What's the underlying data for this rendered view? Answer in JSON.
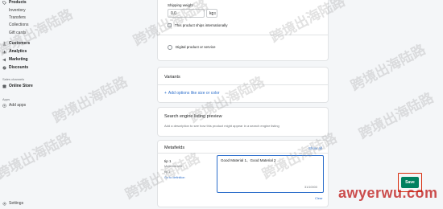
{
  "sidebar": {
    "items": [
      {
        "label": "Products",
        "icon": "tag-icon"
      },
      {
        "label": "Inventory"
      },
      {
        "label": "Transfers"
      },
      {
        "label": "Collections"
      },
      {
        "label": "Gift cards"
      },
      {
        "label": "Customers",
        "icon": "person-icon"
      },
      {
        "label": "Analytics",
        "icon": "chart-icon"
      },
      {
        "label": "Marketing",
        "icon": "megaphone-icon"
      },
      {
        "label": "Discounts",
        "icon": "discount-icon"
      }
    ],
    "sales_channels_label": "Sales channels",
    "online_store_label": "Online Store",
    "apps_label": "Apps",
    "add_apps_label": "Add apps",
    "settings_label": "Settings"
  },
  "shipping": {
    "weight_label": "Shipping weight",
    "weight_value": "0.0",
    "weight_unit": "kg",
    "ships_intl_label": "This product ships internationally",
    "digital_label": "Digital product or service"
  },
  "variants": {
    "title": "Variants",
    "add_options_label": "Add options like size or color"
  },
  "seo": {
    "title": "Search engine listing preview",
    "description": "Add a description to see how this product might appear in a search engine listing"
  },
  "metafields": {
    "title": "Metafields",
    "show_all_label": "Show all",
    "field_name": "tip 1",
    "field_type": "Multi-line text",
    "field_key": "tip 1",
    "go_to_definition_label": "Go to definition",
    "field_value": "Good Material 1、Good Material 2",
    "char_count": "31/10000",
    "clear_label": "Clear"
  },
  "actions": {
    "save_label": "Save"
  },
  "watermark": {
    "text": "跨境出海陆路",
    "brand": "awyerwu.com"
  },
  "colors": {
    "primary": "#008060",
    "link": "#2c6ecb",
    "highlight": "#d82c0d",
    "focus": "#2c6ecb"
  }
}
